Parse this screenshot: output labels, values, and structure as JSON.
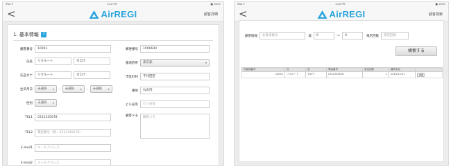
{
  "left": {
    "status": {
      "carrier": "iPad ✈",
      "time": "4:22 PM",
      "battery": "■ 100%"
    },
    "nav": {
      "back_glyph": "<",
      "logo": "AirREGI",
      "link": "顧客詳細"
    },
    "section": {
      "title": "1. 基本情報",
      "help": "?"
    },
    "fields": {
      "customer_no": {
        "label": "顧客番号",
        "value": "10001"
      },
      "name": {
        "label": "氏名",
        "last": "リクルート",
        "first": "タロウ"
      },
      "kana": {
        "label": "氏名カナ",
        "last": "リクルート",
        "first": "タロウ"
      },
      "birthday": {
        "label": "生年月日",
        "year": "未選択",
        "month": "未選択",
        "day": "未選択"
      },
      "gender": {
        "label": "性別",
        "value": "未選択"
      },
      "tel1": {
        "label": "TEL1",
        "value": "0312345678"
      },
      "tel2": {
        "label": "TEL2",
        "placeholder": "電話番号（例：0312345678）"
      },
      "email1": {
        "label": "E-mail1",
        "placeholder": "メールアドレス"
      },
      "email2": {
        "label": "E-mail2",
        "placeholder": "メールアドレス"
      },
      "postal": {
        "label": "郵便番号",
        "value": "1006640"
      },
      "prefecture": {
        "label": "都道府県",
        "value": "東京都"
      },
      "city": {
        "label": "市区町村",
        "value": "千代田区"
      },
      "address": {
        "label": "番地",
        "value": "丸の内"
      },
      "building": {
        "label": "ビル名等",
        "value": "ビル名等"
      },
      "memo": {
        "label": "顧客メモ",
        "value": "顧客メモ"
      }
    }
  },
  "right": {
    "status": {
      "carrier": "iPad ✈",
      "time": "4:22 PM",
      "battery": "■ 100%"
    },
    "nav": {
      "back_glyph": "<",
      "logo": "AirREGI",
      "link": "顧客検索"
    },
    "search": {
      "customer_label": "顧客情報",
      "customer_placeholder": "お客様番号",
      "age_label": "歳",
      "age_from": "0",
      "age_sep": "〜",
      "age_to": "0",
      "visit_label": "来店回数",
      "visit_placeholder": "来店回数",
      "button": "検索する"
    },
    "table": {
      "headers": [
        "お客様番号",
        "氏",
        "名",
        "電話番号",
        "来店回数",
        "最終来店",
        ""
      ],
      "rows": [
        {
          "no": "10001",
          "last": "リクルート",
          "first": "タロウ",
          "tel": "0312345678",
          "visits": "1",
          "last_visit": "2016/11/01",
          "action": "詳細"
        }
      ]
    }
  }
}
